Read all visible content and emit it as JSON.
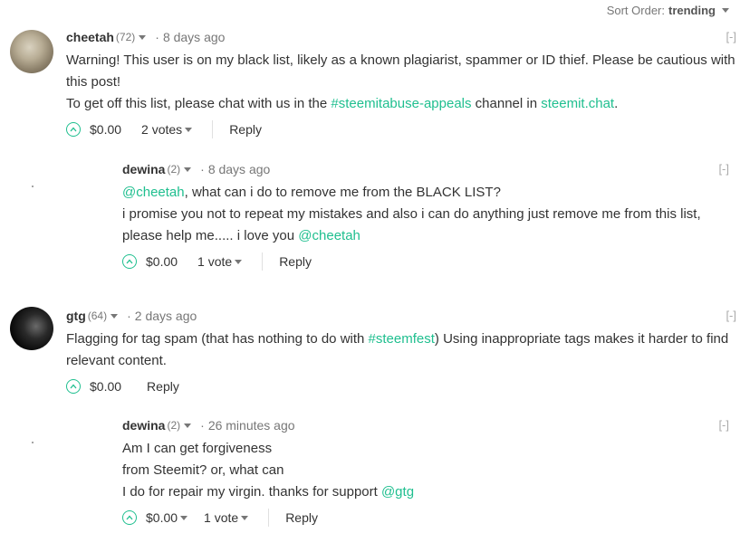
{
  "sort": {
    "label": "Sort Order:",
    "value": "trending"
  },
  "collapse_label": "[-]",
  "comments": [
    {
      "author": "cheetah",
      "rep": "(72)",
      "time": "8 days ago",
      "lines": {
        "l1": "Warning! This user is on my black list, likely as a known plagiarist, spammer or ID thief. Please be cautious with this post!",
        "l2_pre": "To get off this list, please chat with us in the ",
        "l2_link1": "#steemitabuse-appeals",
        "l2_mid": " channel in ",
        "l2_link2": "steemit.chat",
        "l2_post": "."
      },
      "payout": "$0.00",
      "votes": "2 votes",
      "reply": "Reply"
    },
    {
      "author": "dewina",
      "rep": "(2)",
      "time": "8 days ago",
      "lines": {
        "l1_link": "@cheetah",
        "l1_rest": ", what can i do to remove me from the BLACK LIST?",
        "l2": "i promise you not to repeat my mistakes and also i can do anything just remove me from this list, please help me..... i love you ",
        "l2_link": "@cheetah"
      },
      "payout": "$0.00",
      "votes": "1 vote",
      "reply": "Reply"
    },
    {
      "author": "gtg",
      "rep": "(64)",
      "time": "2 days ago",
      "lines": {
        "l1_pre": "Flagging for tag spam (that has nothing to do with ",
        "l1_link": "#steemfest",
        "l1_post": ") Using inappropriate tags makes it harder to find relevant content."
      },
      "payout": "$0.00",
      "reply": "Reply"
    },
    {
      "author": "dewina",
      "rep": "(2)",
      "time": "26 minutes ago",
      "lines": {
        "l1": "Am I can get forgiveness",
        "l2": "from Steemit? or, what can",
        "l3_pre": "I do for repair my virgin. thanks for support ",
        "l3_link": "@gtg"
      },
      "payout": "$0.00",
      "votes": "1 vote",
      "reply": "Reply"
    }
  ],
  "colors": {
    "link": "#1fbf8f",
    "text": "#333333",
    "muted": "#777777"
  }
}
